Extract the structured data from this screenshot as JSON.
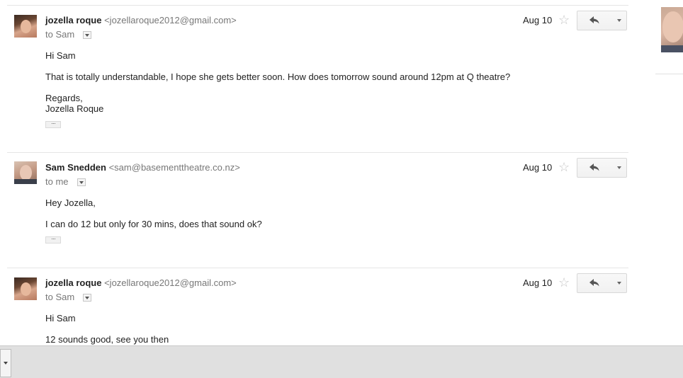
{
  "messages": [
    {
      "sender_name": "jozella roque",
      "sender_email": "<jozellaroque2012@gmail.com>",
      "to": "to Sam",
      "date": "Aug 10",
      "body": [
        "Hi Sam",
        "That is totally understandable, I hope she gets better soon. How does tomorrow sound around 12pm at Q theatre?",
        "Regards,",
        "Jozella Roque"
      ]
    },
    {
      "sender_name": "Sam Snedden",
      "sender_email": "<sam@basementtheatre.co.nz>",
      "to": "to me",
      "date": "Aug 10",
      "body": [
        "Hey Jozella,",
        "I can do 12 but only for 30 mins, does that sound ok?"
      ]
    },
    {
      "sender_name": "jozella roque",
      "sender_email": "<jozellaroque2012@gmail.com>",
      "to": "to Sam",
      "date": "Aug 10",
      "body": [
        "Hi Sam",
        "12 sounds good, see you then"
      ]
    }
  ],
  "icons": {
    "star": "star-icon",
    "reply": "reply-arrow-icon",
    "more": "chevron-down-icon",
    "show_trimmed": "ellipsis-icon"
  },
  "colors": {
    "sender_text": "#222222",
    "meta_text": "#777777",
    "star_outline": "#c6c6c6",
    "bottom_bar": "#e0e0e0"
  }
}
